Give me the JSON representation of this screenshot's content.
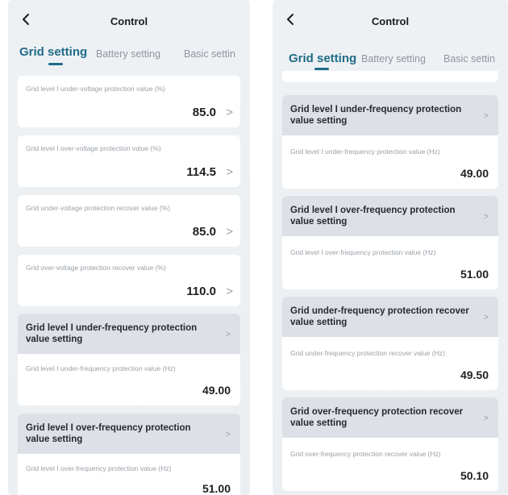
{
  "left": {
    "title": "Control",
    "tabs": [
      "Grid setting",
      "Battery setting",
      "Basic settin"
    ],
    "voltage_cards": [
      {
        "label": "Grid level I under-voltage protection value (%)",
        "value": "85.0",
        "chevron": ">"
      },
      {
        "label": "Grid level I over-voltage protection value (%)",
        "value": "114.5",
        "chevron": ">"
      },
      {
        "label": "Grid under-voltage protection recover value (%)",
        "value": "85.0",
        "chevron": ">"
      },
      {
        "label": "Grid over-voltage protection recover value (%)",
        "value": "110.0",
        "chevron": ">"
      }
    ],
    "freq_cards": [
      {
        "title": "Grid level I under-frequency protection value setting",
        "label": "Grid level I under-frequency protection value (Hz)",
        "value": "49.00",
        "chevron": ">"
      },
      {
        "title": "Grid level I over-frequency protection value setting",
        "label": "Grid level I over-frequency protection value (Hz)",
        "value": "51.00",
        "chevron": ">"
      }
    ]
  },
  "right": {
    "title": "Control",
    "tabs": [
      "Grid setting",
      "Battery setting",
      "Basic settin"
    ],
    "freq_cards": [
      {
        "title": "Grid level I under-frequency protection value setting",
        "label": "Grid level I under-frequency protection value (Hz)",
        "value": "49.00",
        "chevron": ">"
      },
      {
        "title": "Grid level I over-frequency protection value setting",
        "label": "Grid level I over-frequency protection value (Hz)",
        "value": "51.00",
        "chevron": ">"
      },
      {
        "title": "Grid under-frequency protection recover value setting",
        "label": "Grid under-frequency protection recover value (Hz)",
        "value": "49.50",
        "chevron": ">"
      },
      {
        "title": "Grid over-frequency protection recover value setting",
        "label": "Grid over-frequency protection recover value (Hz)",
        "value": "50.10",
        "chevron": ">"
      }
    ]
  },
  "icons": {
    "back": "chevron-left-icon",
    "row_chevron": "chevron-right-icon"
  },
  "colors": {
    "accent": "#1e6b87",
    "panel_bg": "#eef1f4",
    "header_card_bg": "#dde1e7",
    "muted_text": "#9aa1a8"
  }
}
